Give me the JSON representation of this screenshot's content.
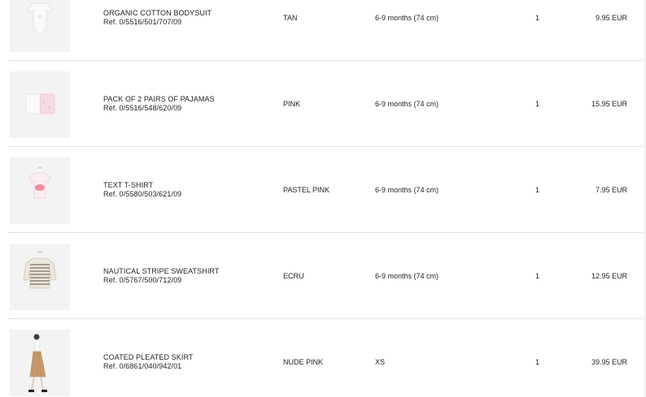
{
  "items": [
    {
      "name": "ORGANIC COTTON BODYSUIT",
      "ref": "Ref. 0/5516/501/707/09",
      "color": "TAN",
      "size": "6-9 months (74 cm)",
      "qty": "1",
      "price": "9.95 EUR",
      "image_icon": "bodysuit-image"
    },
    {
      "name": "PACK OF 2 PAIRS OF PAJAMAS",
      "ref": "Ref. 0/5516/548/620/09",
      "color": "PINK",
      "size": "6-9 months (74 cm)",
      "qty": "1",
      "price": "15.95 EUR",
      "image_icon": "pajamas-image"
    },
    {
      "name": "TEXT T-SHIRT",
      "ref": "Ref. 0/5580/503/621/09",
      "color": "PASTEL PINK",
      "size": "6-9 months (74 cm)",
      "qty": "1",
      "price": "7.95 EUR",
      "image_icon": "tshirt-image"
    },
    {
      "name": "NAUTICAL STRIPE SWEATSHIRT",
      "ref": "Ref. 0/5767/500/712/09",
      "color": "ECRU",
      "size": "6-9 months (74 cm)",
      "qty": "1",
      "price": "12.95 EUR",
      "image_icon": "sweatshirt-image"
    },
    {
      "name": "COATED PLEATED SKIRT",
      "ref": "Ref. 0/6861/040/942/01",
      "color": "NUDE PINK",
      "size": "XS",
      "qty": "1",
      "price": "39.95 EUR",
      "image_icon": "skirt-image"
    }
  ]
}
